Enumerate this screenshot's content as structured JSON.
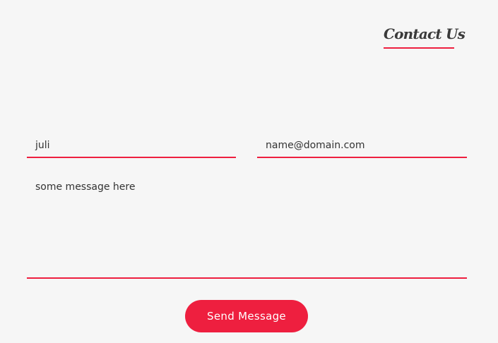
{
  "contact": {
    "heading": "Contact Us"
  },
  "form": {
    "name_value": "juli",
    "email_value": "name@domain.com",
    "message_value": "some message here",
    "send_label": "Send Message"
  },
  "colors": {
    "accent": "#ee1f3f",
    "background": "#f6f6f6",
    "text": "#333333"
  }
}
